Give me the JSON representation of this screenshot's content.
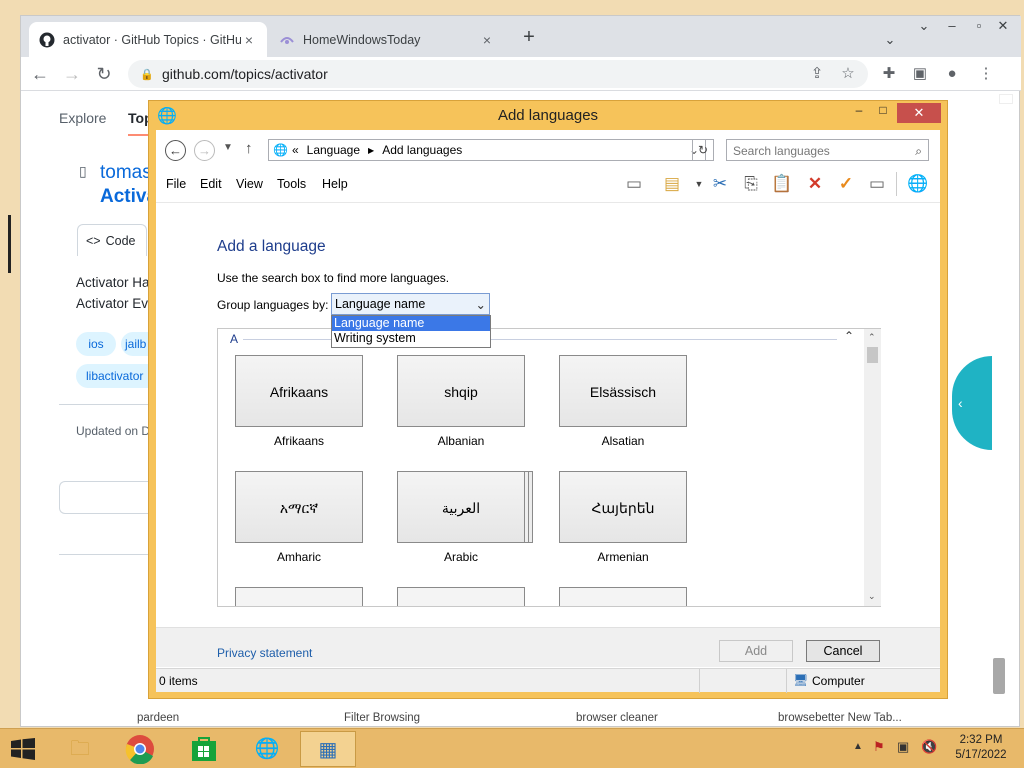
{
  "browser": {
    "tabs": [
      {
        "title": "activator · GitHub Topics · GitHub",
        "close": "×"
      },
      {
        "title": "HomeWindowsToday",
        "close": "×"
      }
    ],
    "new_tab": "+",
    "url": "github.com/topics/activator"
  },
  "github": {
    "nav_explore": "Explore",
    "nav_topics": "Top",
    "repo_owner": "tomas",
    "repo_name": "Activa",
    "code_tab": "Code",
    "desc_line1": "Activator Ha",
    "desc_line2": "Activator Ev",
    "topic_tags": [
      "ios",
      "jailb",
      "libactivator"
    ],
    "updated": "Updated on D",
    "bottom_cut": [
      "pardeen",
      "Filter Browsing",
      "browser cleaner",
      "browsebetter New Tab..."
    ]
  },
  "dialog": {
    "title": "Add languages",
    "breadcrumb": [
      "Language",
      "Add languages"
    ],
    "breadcrumb_prefix": "«",
    "search_placeholder": "Search languages",
    "menu": [
      "File",
      "Edit",
      "View",
      "Tools",
      "Help"
    ],
    "heading": "Add a language",
    "hint": "Use the search box to find more languages.",
    "group_label": "Group languages by:",
    "group_selected": "Language name",
    "group_options": [
      "Language name",
      "Writing system"
    ],
    "section_letter": "A",
    "languages": [
      {
        "native": "Afrikaans",
        "name": "Afrikaans"
      },
      {
        "native": "shqip",
        "name": "Albanian"
      },
      {
        "native": "Elsässisch",
        "name": "Alsatian"
      },
      {
        "native": "አማርኛ",
        "name": "Amharic"
      },
      {
        "native": "العربية",
        "name": "Arabic"
      },
      {
        "native": "Հայերեն",
        "name": "Armenian"
      }
    ],
    "privacy": "Privacy statement",
    "add_button": "Add",
    "cancel_button": "Cancel",
    "status_items": "0 items",
    "status_location": "Computer"
  },
  "taskbar": {
    "time": "2:32 PM",
    "date": "5/17/2022"
  }
}
